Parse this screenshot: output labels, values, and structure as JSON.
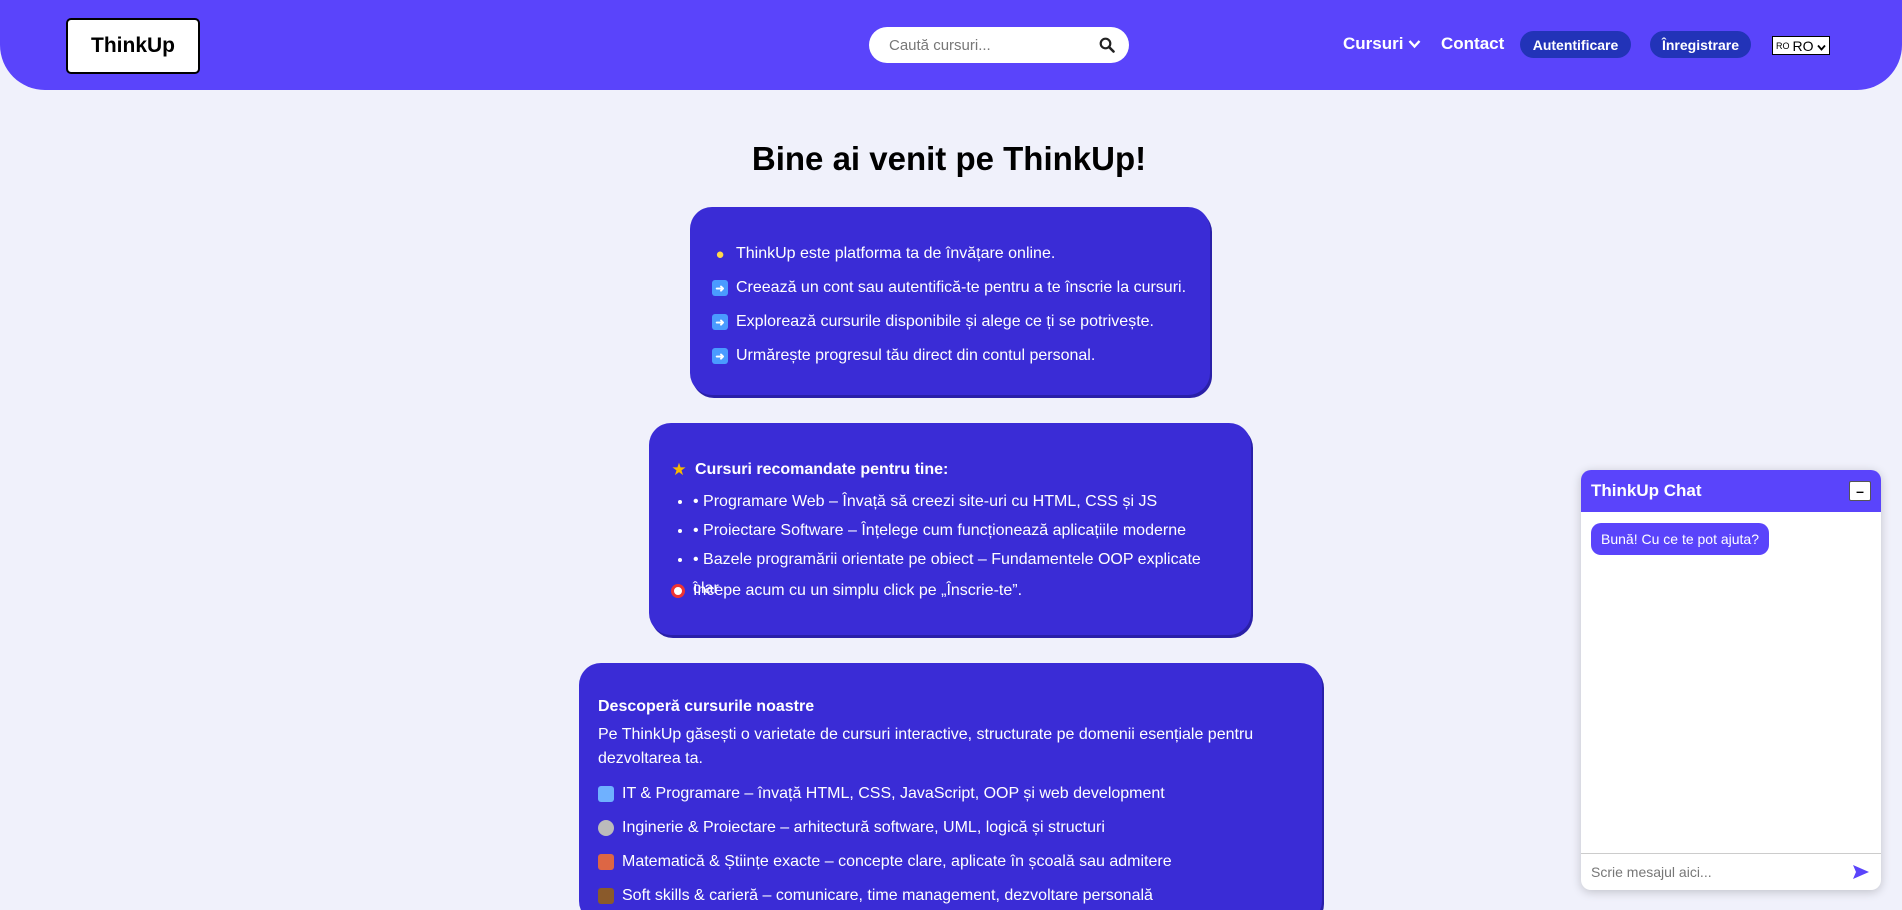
{
  "header": {
    "logo": "ThinkUp",
    "search_placeholder": "Caută cursuri...",
    "nav_courses": "Cursuri",
    "nav_contact": "Contact",
    "login": "Autentificare",
    "register": "Înregistrare",
    "lang_code": "RO",
    "lang_flag_text": "RO"
  },
  "main": {
    "title": "Bine ai venit pe ThinkUp!",
    "intro": [
      "ThinkUp este platforma ta de învățare online.",
      "Creează un cont sau autentifică-te pentru a te înscrie la cursuri.",
      "Explorează cursurile disponibile și alege ce ți se potrivește.",
      "Urmărește progresul tău direct din contul personal."
    ],
    "recommended_heading": "Cursuri recomandate pentru tine:",
    "recommended": [
      "• Programare Web – Învață să creezi site-uri cu HTML, CSS și JS",
      "• Proiectare Software – Înțelege cum funcționează aplicațiile moderne",
      "• Bazele programării orientate pe obiect – Fundamentele OOP explicate clar"
    ],
    "recommended_cta": "Începe acum cu un simplu click pe „Înscrie-te”.",
    "discover_heading": "Descoperă cursurile noastre",
    "discover_text": "Pe ThinkUp găsești o varietate de cursuri interactive, structurate pe domenii esențiale pentru dezvoltarea ta.",
    "domains": [
      "IT & Programare – învață HTML, CSS, JavaScript, OOP și web development",
      "Inginerie & Proiectare – arhitectură software, UML, logică și structuri",
      "Matematică & Științe exacte – concepte clare, aplicate în școală sau admitere",
      "Soft skills & carieră – comunicare, time management, dezvoltare personală"
    ]
  },
  "chat": {
    "title": "ThinkUp Chat",
    "minimize": "–",
    "greeting": "Bună! Cu ce te pot ajuta?",
    "input_placeholder": "Scrie mesajul aici..."
  },
  "colors": {
    "header_bg": "#5a44fb",
    "card_bg": "#3a2cd6",
    "button_bg": "#2233b8",
    "page_bg": "#f0f1fb"
  },
  "icons": {
    "intro_first": "light-bulb-icon",
    "intro_rest": "right-arrow-icon",
    "recommended": "star-icon",
    "cta": "target-icon",
    "domains": [
      "laptop-icon",
      "gear-icon",
      "abacus-icon",
      "briefcase-icon"
    ]
  }
}
